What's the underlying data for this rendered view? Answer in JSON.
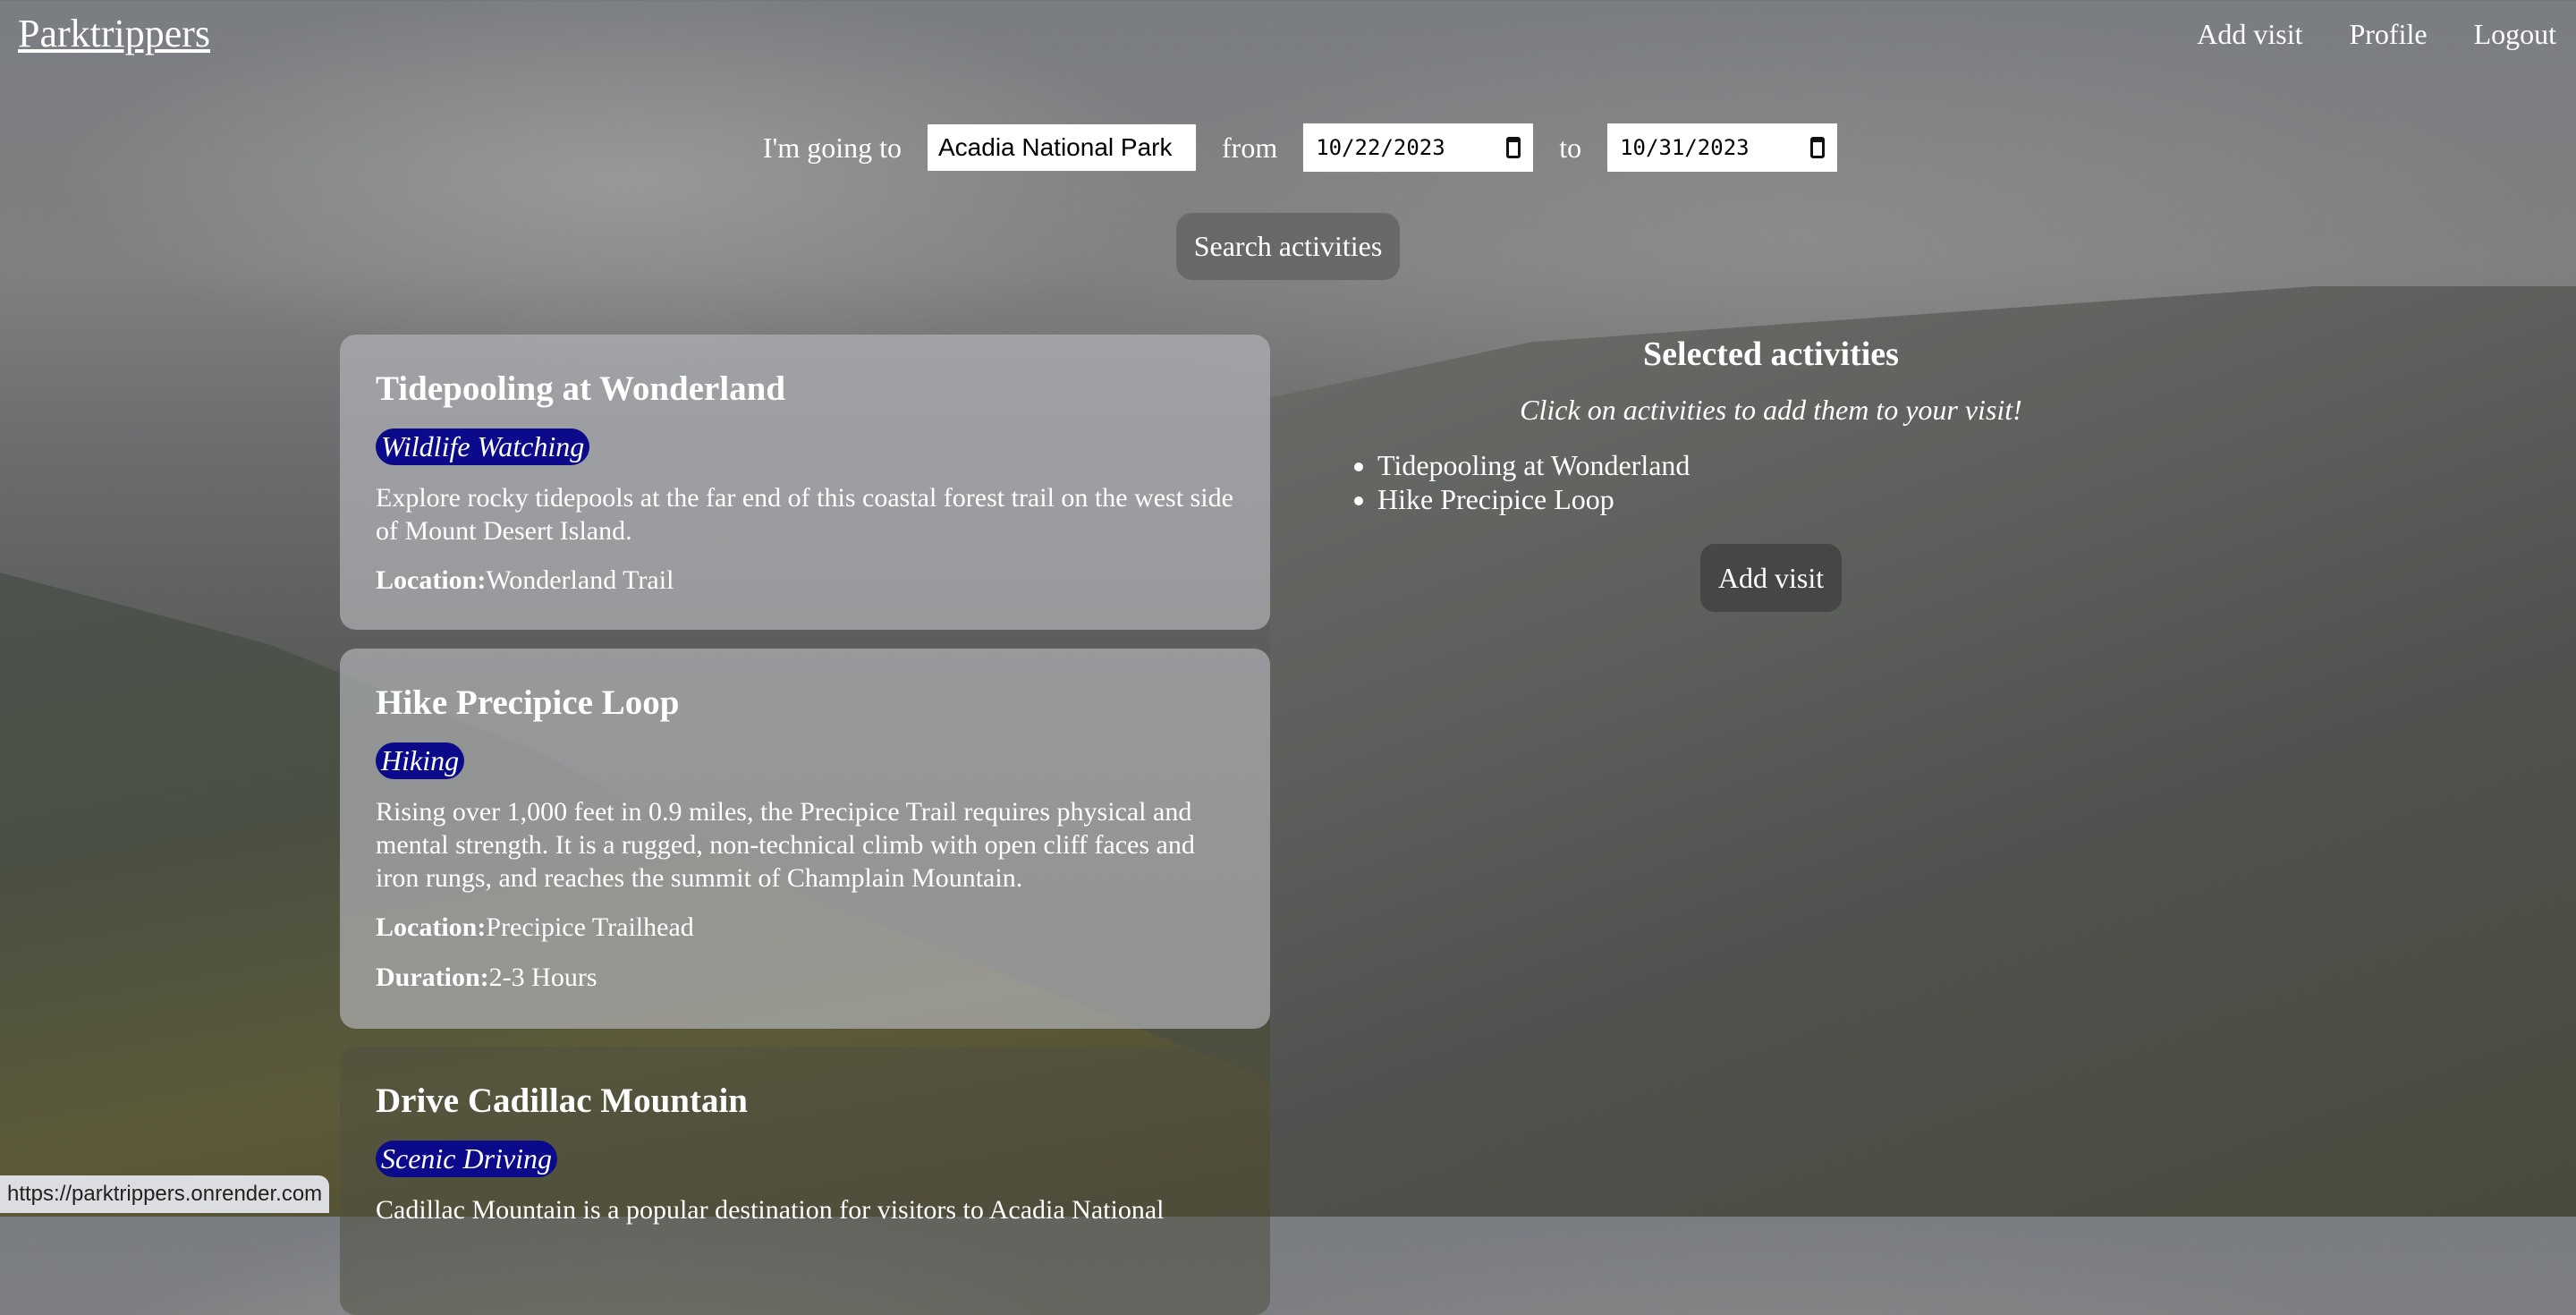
{
  "nav": {
    "brand": "Parktrippers",
    "links": [
      "Add visit",
      "Profile",
      "Logout"
    ]
  },
  "search": {
    "going_label": "I'm going to",
    "park_value": "Acadia National Park",
    "from_label": "from",
    "from_date": "10/22/2023",
    "to_label": "to",
    "to_date": "10/31/2023",
    "button_label": "Search activities"
  },
  "activities": [
    {
      "title": "Tidepooling at Wonderland",
      "category": "Wildlife Watching",
      "description": "Explore rocky tidepools at the far end of this coastal forest trail on the west side of Mount Desert Island.",
      "location_label": "Location:",
      "location": "Wonderland Trail"
    },
    {
      "title": "Hike Precipice Loop",
      "category": "Hiking",
      "description": "Rising over 1,000 feet in 0.9 miles, the Precipice Trail requires physical and mental strength. It is a rugged, non-technical climb with open cliff faces and iron rungs, and reaches the summit of Champlain Mountain.",
      "location_label": "Location:",
      "location": "Precipice Trailhead",
      "duration_label": "Duration:",
      "duration": "2-3 Hours"
    },
    {
      "title": "Drive Cadillac Mountain",
      "category": "Scenic Driving",
      "description": "Cadillac Mountain is a popular destination for visitors to Acadia National"
    }
  ],
  "selected": {
    "title": "Selected activities",
    "hint": "Click on activities to add them to your visit!",
    "items": [
      "Tidepooling at Wonderland",
      "Hike Precipice Loop"
    ],
    "button_label": "Add visit"
  },
  "status_bar": {
    "url": "https://parktrippers.onrender.com"
  },
  "colors": {
    "badge": "#0a0a8a"
  }
}
